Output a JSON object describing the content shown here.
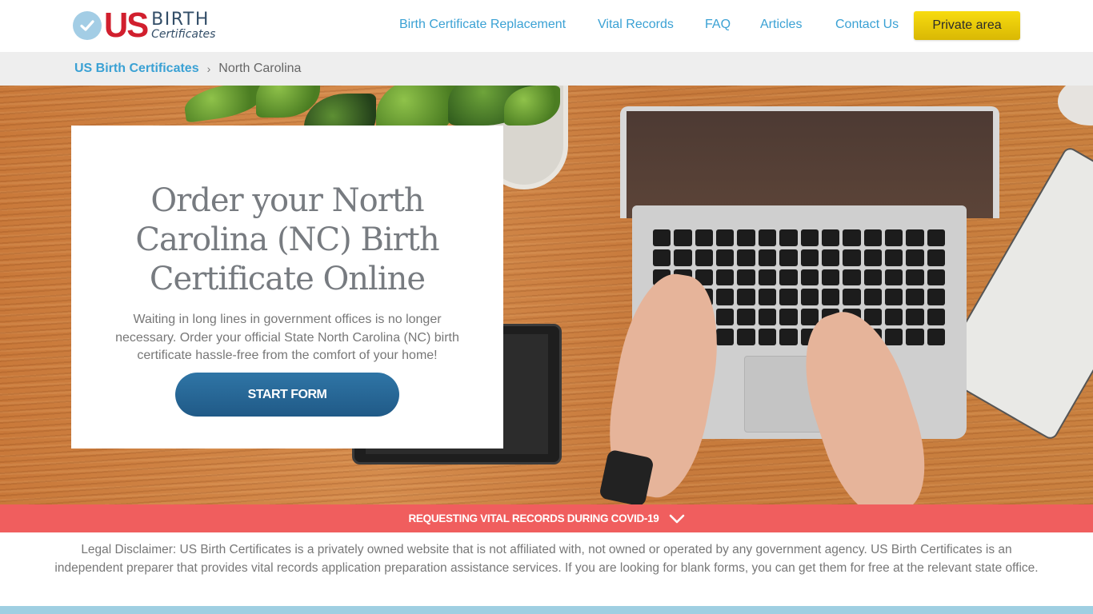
{
  "header": {
    "logo": {
      "mark": "US",
      "word1": "BIRTH",
      "word2": "Certificates",
      "icon": "checkmark-circle-icon"
    },
    "nav": [
      {
        "label": "Birth Certificate Replacement"
      },
      {
        "label": "Vital Records"
      },
      {
        "label": "FAQ"
      },
      {
        "label": "Articles"
      },
      {
        "label": "Contact Us"
      }
    ],
    "private_area_label": "Private area"
  },
  "breadcrumb": {
    "home": "US Birth Certificates",
    "separator": "›",
    "current": "North Carolina"
  },
  "hero": {
    "title": "Order your North Carolina (NC) Birth Certificate Online",
    "description": "Waiting in long lines in government offices is no longer necessary. Order your official State North Carolina (NC) birth certificate hassle-free from the comfort of your home!",
    "cta_label": "START FORM"
  },
  "covid_banner": {
    "label": "REQUESTING VITAL RECORDS DURING COVID-19",
    "icon": "chevron-down-icon"
  },
  "disclaimer": "Legal Disclaimer: US Birth Certificates is a privately owned website that is not affiliated with, not owned or operated by any government agency. US Birth Certificates is an independent preparer that provides vital records application preparation assistance services. If you are looking for blank forms, you can get them for free at the relevant state office.",
  "colors": {
    "brand_red": "#d11f2e",
    "brand_navy": "#334e68",
    "link_blue": "#3aa1d4",
    "cta_yellow": "#f2d20a",
    "cta_blue": "#2a6b9a",
    "covid_red": "#f05e5e",
    "footer_blue": "#9fcfe2"
  }
}
